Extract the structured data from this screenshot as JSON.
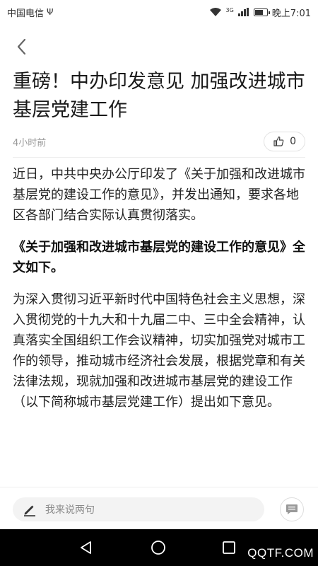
{
  "status_bar": {
    "carrier": "中国电信",
    "network_type": "3G",
    "time": "晚上7:01",
    "battery_level": 0.75
  },
  "article": {
    "title": "重磅！中办印发意见 加强改进城市基层党建工作",
    "time": "4小时前",
    "likes": "0",
    "paragraphs": [
      {
        "text": "近日，中共中央办公厅印发了《关于加强和改进城市基层党的建设工作的意见》，并发出通知，要求各地区各部门结合实际认真贯彻落实。",
        "bold": false
      },
      {
        "text": "《关于加强和改进城市基层党的建设工作的意见》全文如下。",
        "bold": true
      },
      {
        "text": "为深入贯彻习近平新时代中国特色社会主义思想，深入贯彻党的十九大和十九届二中、三中全会精神，认真落实全国组织工作会议精神，切实加强党对城市工作的领导，推动城市经济社会发展，根据党章和有关法律法规，现就加强和改进城市基层党的建设工作（以下简称城市基层党建工作）提出如下意见。",
        "bold": false
      }
    ]
  },
  "comment_bar": {
    "placeholder": "我来说两句"
  },
  "watermark": "QQTF.COM",
  "icons": {
    "back": "chevron-left-icon",
    "like": "thumbs-up-icon",
    "edit": "pencil-icon",
    "comment": "comment-icon"
  }
}
